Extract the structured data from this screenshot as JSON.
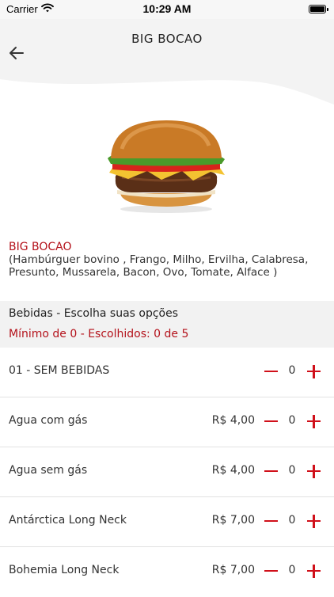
{
  "status": {
    "carrier": "Carrier",
    "time": "10:29 AM"
  },
  "header": {
    "title": "BIG BOCAO"
  },
  "product": {
    "image": "hamburger-photo",
    "name": "BIG BOCAO",
    "description": "(Hambúrguer bovino  , Frango, Milho, Ervilha, Calabresa, Presunto, Mussarela, Bacon, Ovo, Tomate, Alface )"
  },
  "section": {
    "title": "Bebidas - Escolha suas opções",
    "subtitle": "Mínimo de 0 - Escolhidos: 0 de 5"
  },
  "items": [
    {
      "label": "01 - SEM BEBIDAS",
      "price": "",
      "qty": "0"
    },
    {
      "label": "Agua com gás",
      "price": "R$ 4,00",
      "qty": "0"
    },
    {
      "label": "Agua sem gás",
      "price": "R$ 4,00",
      "qty": "0"
    },
    {
      "label": "Antárctica Long Neck",
      "price": "R$ 7,00",
      "qty": "0"
    },
    {
      "label": "Bohemia Long Neck",
      "price": "R$ 7,00",
      "qty": "0"
    }
  ],
  "colors": {
    "accent": "#d0101a",
    "name": "#b4121b",
    "header_bg": "#f3f3f3"
  },
  "icons": {
    "back": "arrow-left-icon",
    "minus": "minus-icon",
    "plus": "plus-icon",
    "wifi": "wifi-icon",
    "battery": "battery-icon"
  }
}
